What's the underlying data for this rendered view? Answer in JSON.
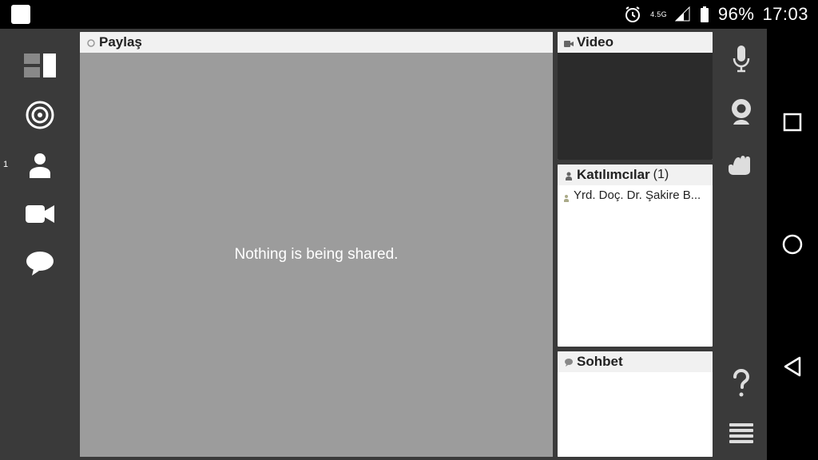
{
  "status": {
    "network": "4.5G",
    "battery": "96%",
    "clock": "17:03"
  },
  "leftbar": {
    "badge": "1"
  },
  "panels": {
    "share": {
      "title": "Paylaş",
      "empty_text": "Nothing is being shared."
    },
    "video": {
      "title": "Video"
    },
    "participants": {
      "title": "Katılımcılar",
      "count": "(1)",
      "items": [
        "Yrd. Doç. Dr. Şakire B..."
      ]
    },
    "chat": {
      "title": "Sohbet"
    }
  }
}
